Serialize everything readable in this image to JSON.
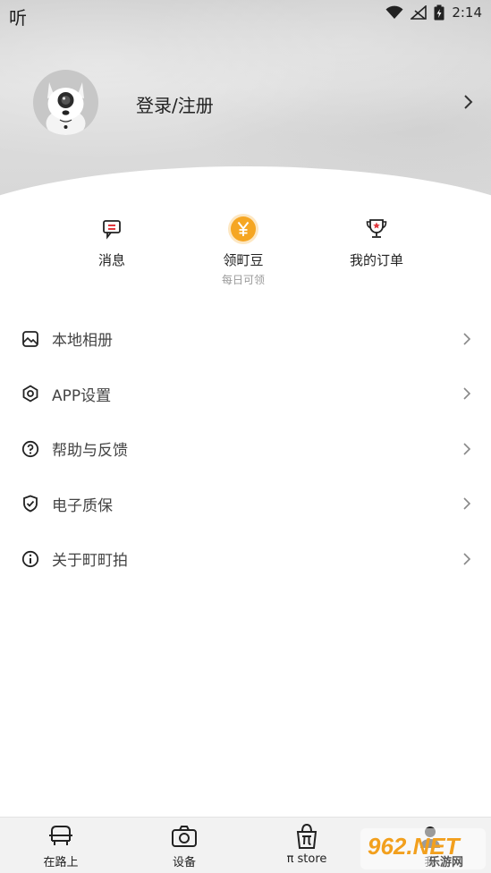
{
  "status_bar": {
    "left_glyph": "听",
    "time": "2:14",
    "icons": [
      "wifi-icon",
      "no-signal-icon",
      "battery-icon"
    ]
  },
  "profile": {
    "login_label": "登录/注册",
    "avatar": "dog-avatar"
  },
  "quick_actions": [
    {
      "label": "消息",
      "icon": "message-icon"
    },
    {
      "label": "领町豆",
      "sub": "每日可领",
      "icon": "yen-coin-icon"
    },
    {
      "label": "我的订单",
      "icon": "trophy-icon"
    }
  ],
  "menu": [
    {
      "label": "本地相册",
      "icon": "album-icon"
    },
    {
      "label": "APP设置",
      "icon": "settings-icon"
    },
    {
      "label": "帮助与反馈",
      "icon": "help-icon"
    },
    {
      "label": "电子质保",
      "icon": "shield-check-icon"
    },
    {
      "label": "关于町町拍",
      "icon": "info-icon"
    }
  ],
  "bottom_nav": [
    {
      "label": "在路上",
      "icon": "car-icon"
    },
    {
      "label": "设备",
      "icon": "camera-icon"
    },
    {
      "label": "π store",
      "icon": "shopping-bag-icon"
    },
    {
      "label": "我",
      "icon": "person-icon"
    }
  ],
  "watermark": {
    "brand": "962.NET",
    "sub": "乐游网"
  },
  "colors": {
    "accent_coin": "#f5a623",
    "icon_red": "#e0383e",
    "nav_bg": "#f2f2f2"
  }
}
